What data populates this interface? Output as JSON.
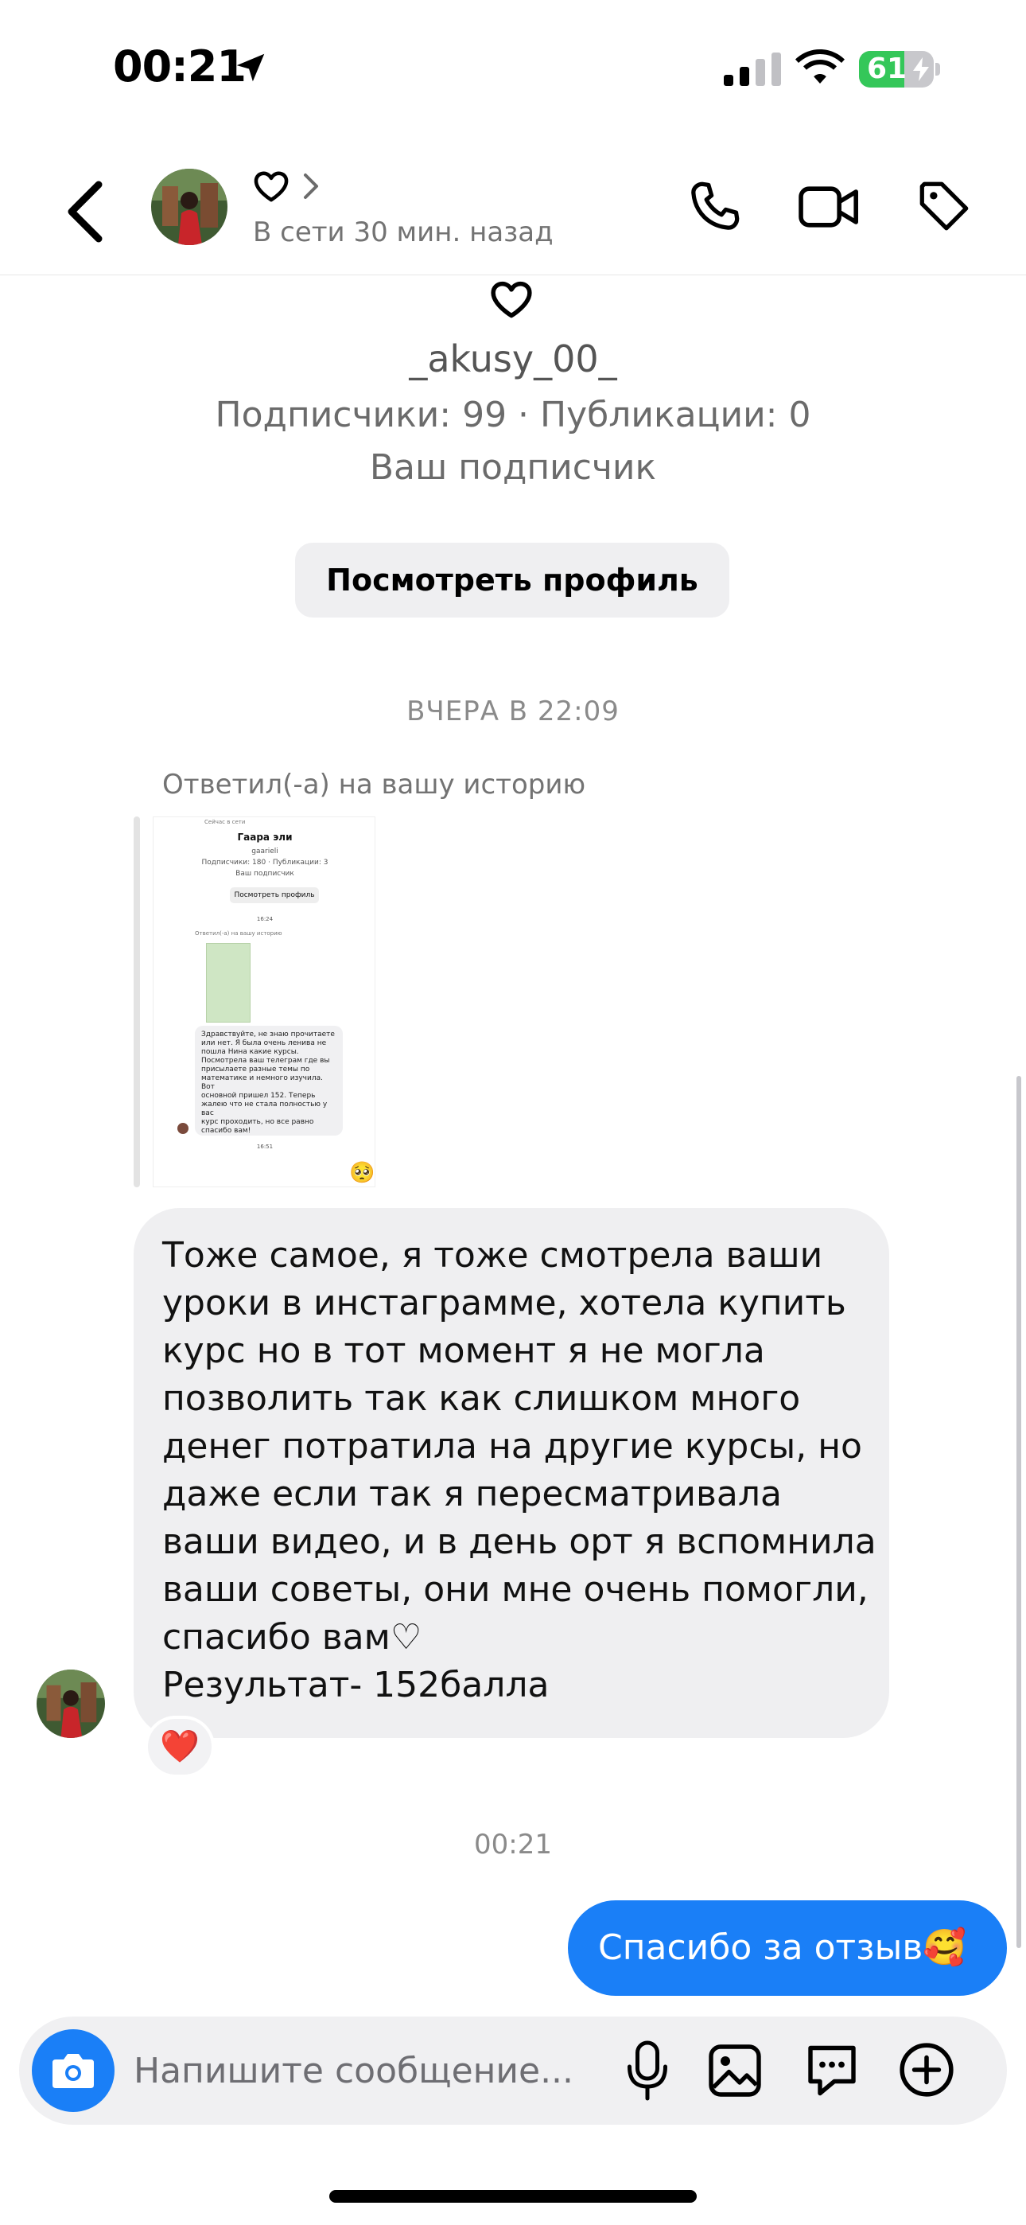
{
  "status_bar": {
    "time": "00:21",
    "battery_percent": 61,
    "battery_label": "61",
    "icons": [
      "location-arrow-icon",
      "cellular-signal-icon",
      "wifi-icon",
      "battery-icon"
    ]
  },
  "header": {
    "status": "В сети 30 мин. назад",
    "icons": [
      "back-chevron-icon",
      "heart-icon",
      "chevron-right-icon",
      "phone-icon",
      "video-camera-icon",
      "tag-icon"
    ]
  },
  "profile": {
    "username": "_akusy_00_",
    "stats": "Подписчики: 99 · Публикации: 0",
    "follow_status": "Ваш подписчик",
    "view_profile_label": "Посмотреть профиль"
  },
  "chat": {
    "day_separator": "ВЧЕРА В 22:09",
    "story_reply_label": "Ответил(-а) на вашу историю",
    "story_preview": {
      "header_status": "Сейчас в сети",
      "title": "Гаара эли",
      "handle": "gaarieli",
      "stats": "Подписчики: 180 · Публикации: 3",
      "follow_status": "Ваш подписчик",
      "button_label": "Посмотреть профиль",
      "time_top": "16:24",
      "reply_label": "Ответил(-а) на вашу историю",
      "message": "Здравствуйте, не знаю прочитаете или нет. Я была очень ленива не пошла Нина какие курсы. Посмотрела ваш телеграм где вы присылаете разные темы по математике и немного изучила. Вот основной пришел 152.    Теперь жалею что не стала полностью у вас курс проходить, но все равно спасибо вам!",
      "message_lines": [
        "Здравствуйте, не знаю прочитаете",
        "или нет. Я была очень ленива не",
        "пошла Нина какие курсы.",
        "Посмотрела ваш телеграм где вы",
        "присылаете разные темы по",
        "математике и немного изучила. Вот",
        "основной пришел 152.     Теперь",
        "жалею что не стала полностью у вас",
        "курс проходить, но все равно",
        "спасибо вам!"
      ],
      "time_bottom": "16:51",
      "emoji": "🥺"
    },
    "incoming_message": {
      "lines": [
        "Тоже самое, я тоже смотрела ваши",
        "уроки в инстаграмме, хотела купить",
        "курс но в тот момент я не могла",
        "позволить так как слишком много",
        "денег потратила на другие курсы, но",
        "даже если так я пересматривала",
        "ваши видео, и в день орт я вспомнила",
        "ваши советы, они мне очень помогли,",
        "спасибо вам♡",
        "Результат- 152балла"
      ],
      "reaction": "❤️"
    },
    "time_separator": "00:21",
    "outgoing_message": "Спасибо за отзыв🥰"
  },
  "composer": {
    "placeholder": "Напишите сообщение...",
    "value": "",
    "icons": [
      "camera-icon",
      "microphone-icon",
      "gallery-icon",
      "sticker-icon",
      "plus-circle-icon"
    ]
  },
  "colors": {
    "accent_blue": "#1a7ff7",
    "bubble_gray": "#efeff1",
    "battery_green": "#34c759",
    "secondary_text": "#737373"
  }
}
